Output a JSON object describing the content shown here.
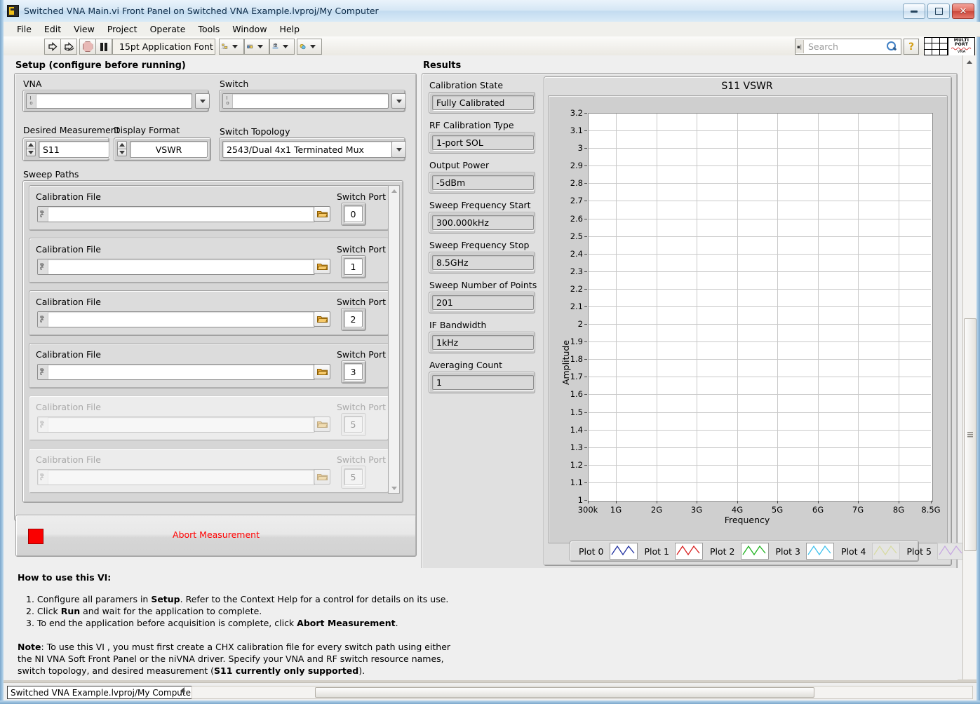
{
  "window": {
    "title": "Switched VNA Main.vi Front Panel on Switched VNA Example.lvproj/My Computer",
    "icon": "labview-vi-icon",
    "minimize": "minimize-icon",
    "restore": "restore-icon",
    "close": "✕"
  },
  "menubar": {
    "items": [
      "File",
      "Edit",
      "View",
      "Project",
      "Operate",
      "Tools",
      "Window",
      "Help"
    ]
  },
  "toolbar": {
    "run_icon": "run-arrow-icon",
    "run_continuous_icon": "run-continuously-icon",
    "abort_icon": "abort-execution-icon",
    "pause_icon": "pause-icon",
    "font_label": "15pt Application Font",
    "align_icon": "align-objects-icon",
    "distribute_icon": "distribute-objects-icon",
    "resize_icon": "resize-objects-icon",
    "reorder_icon": "reorder-objects-icon",
    "search_placeholder": "Search",
    "search_value": "",
    "help_icon": "context-help-icon",
    "logo_line1": "MULTI",
    "logo_line2": "PORT",
    "logo_line3": "VNA"
  },
  "setup": {
    "heading": "Setup (configure before running)",
    "vna_label": "VNA",
    "vna_value": "",
    "switch_label": "Switch",
    "switch_value": "",
    "desired_measurement_label": "Desired Measurement",
    "desired_measurement_value": "S11",
    "display_format_label": "Display Format",
    "display_format_value": "VSWR",
    "switch_topology_label": "Switch Topology",
    "switch_topology_value": "2543/Dual 4x1 Terminated Mux",
    "sweep_paths_label": "Sweep Paths",
    "calibration_file_label": "Calibration File",
    "switch_port_label": "Switch Port",
    "paths": [
      {
        "cal_file": "",
        "port": "0",
        "enabled": true
      },
      {
        "cal_file": "",
        "port": "1",
        "enabled": true
      },
      {
        "cal_file": "",
        "port": "2",
        "enabled": true
      },
      {
        "cal_file": "",
        "port": "3",
        "enabled": true
      },
      {
        "cal_file": "",
        "port": "5",
        "enabled": false
      },
      {
        "cal_file": "",
        "port": "5",
        "enabled": false
      }
    ]
  },
  "abort": {
    "label": "Abort Measurement",
    "led_color": "#fa0000"
  },
  "results": {
    "heading": "Results",
    "fields": [
      {
        "label": "Calibration State",
        "value": "Fully Calibrated"
      },
      {
        "label": "RF Calibration Type",
        "value": "1-port SOL"
      },
      {
        "label": "Output Power",
        "value": "-5dBm"
      },
      {
        "label": "Sweep Frequency Start",
        "value": "300.000kHz"
      },
      {
        "label": "Sweep Frequency Stop",
        "value": "8.5GHz"
      },
      {
        "label": "Sweep Number of Points",
        "value": "201"
      },
      {
        "label": "IF Bandwidth",
        "value": "1kHz"
      },
      {
        "label": "Averaging Count",
        "value": "1"
      }
    ]
  },
  "chart_data": {
    "type": "line",
    "title": "S11 VSWR",
    "xlabel": "Frequency",
    "ylabel": "Amplitude",
    "grid": true,
    "legend_position": "bottom",
    "ylim": [
      1,
      3.2
    ],
    "yticks": [
      "3.2",
      "3.1",
      "3",
      "2.9",
      "2.8",
      "2.7",
      "2.6",
      "2.5",
      "2.4",
      "2.3",
      "2.2",
      "2.1",
      "2",
      "1.9",
      "1.8",
      "1.7",
      "1.6",
      "1.5",
      "1.4",
      "1.3",
      "1.2",
      "1.1",
      "1"
    ],
    "xticks": [
      "300k",
      "1G",
      "2G",
      "3G",
      "4G",
      "5G",
      "6G",
      "7G",
      "8G",
      "8.5G"
    ],
    "xlim_labels": [
      "300k",
      "8.5G"
    ],
    "series": [
      {
        "name": "Plot 0",
        "color": "#1f2fa0",
        "values": [],
        "enabled": true
      },
      {
        "name": "Plot 1",
        "color": "#d81f1f",
        "values": [],
        "enabled": true
      },
      {
        "name": "Plot 2",
        "color": "#1fb21f",
        "values": [],
        "enabled": true
      },
      {
        "name": "Plot 3",
        "color": "#3fc2ee",
        "values": [],
        "enabled": true
      },
      {
        "name": "Plot 4",
        "color": "#d7dba2",
        "values": [],
        "enabled": false
      },
      {
        "name": "Plot 5",
        "color": "#c7a8e2",
        "values": [],
        "enabled": false
      }
    ]
  },
  "help": {
    "heading": "How to use this VI:",
    "steps": [
      {
        "num": "1.",
        "pre": "Configure all paramers in ",
        "bold": "Setup",
        "post": ".  Refer to the Context Help for a control for details on its use."
      },
      {
        "num": "2.",
        "pre": "Click ",
        "bold": "Run",
        "post": " and wait for the application to complete."
      },
      {
        "num": "3.",
        "pre": "To end the application before acquisition is complete, click ",
        "bold": "Abort Measurement",
        "post": "."
      }
    ],
    "note_bold": "Note",
    "note_lines": [
      ": To use this VI , you must first create a CHX calibration file for every switch path using either",
      "the NI VNA Soft Front Panel or the niVNA driver.  Specify your VNA and RF switch resource names,",
      "switch topology, and desired measurement (S11 currently only supported)."
    ],
    "note_line3_pre": "switch topology, and desired measurement (",
    "note_line3_bold": "S11 currently only supported",
    "note_line3_post": ")."
  },
  "statusbar": {
    "project_label": "Switched VNA Example.lvproj/My Computer",
    "collapse_icon": "collapse-arrow-icon"
  }
}
